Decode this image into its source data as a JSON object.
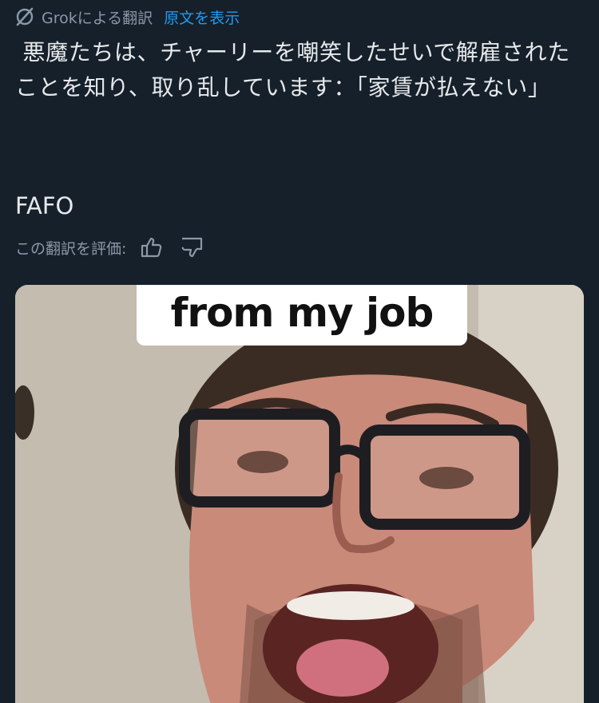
{
  "translation_bar": {
    "icon": "grok-slash-icon",
    "label": "Grokによる翻訳",
    "show_original": "原文を表示"
  },
  "tweet": {
    "text": " 悪魔たちは、チャーリーを嘲笑したせいで解雇されたことを知り、取り乱しています：「家賃が払えない」",
    "tag": "FAFO"
  },
  "rating": {
    "label": "この翻訳を評価:",
    "thumbs_up_icon": "thumbs-up-icon",
    "thumbs_down_icon": "thumbs-down-icon"
  },
  "media": {
    "caption": "from my job"
  },
  "colors": {
    "background": "#15202b",
    "text": "#e7e9ea",
    "muted": "#8b98a5",
    "link": "#1d9bf0"
  }
}
